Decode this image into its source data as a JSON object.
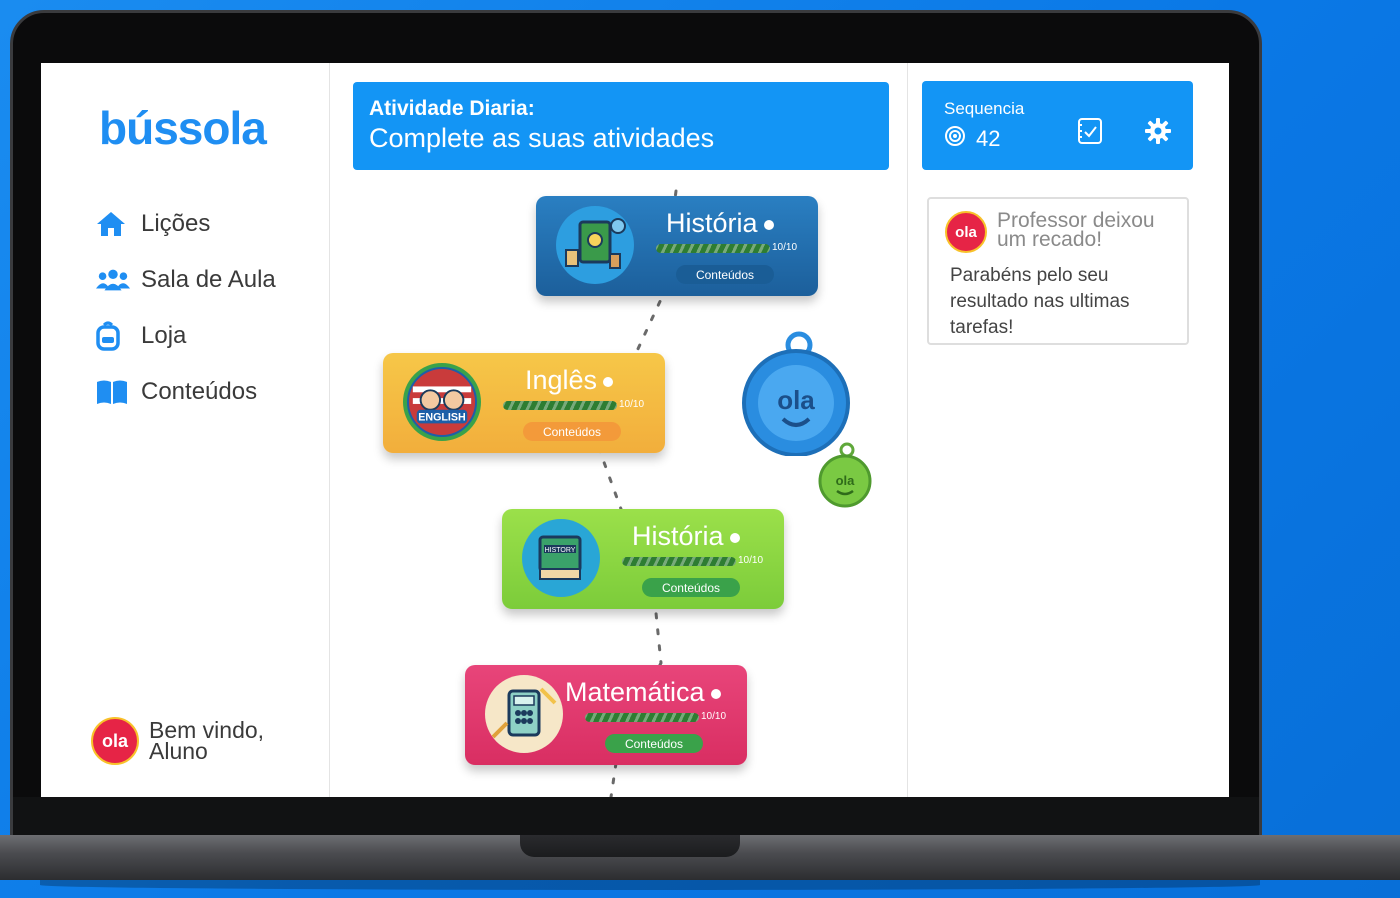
{
  "brand": {
    "logo": "bússola"
  },
  "sidebar": {
    "items": [
      {
        "label": "Lições",
        "icon": "home-icon"
      },
      {
        "label": "Sala de Aula",
        "icon": "users-icon"
      },
      {
        "label": "Loja",
        "icon": "backpack-icon"
      },
      {
        "label": "Conteúdos",
        "icon": "book-icon"
      }
    ],
    "welcome_line1": "Bem vindo,",
    "welcome_line2": "Aluno",
    "avatar_text": "ola"
  },
  "daily": {
    "title": "Atividade Diaria:",
    "subtitle": "Complete as suas atividades"
  },
  "lessons": [
    {
      "title": "História",
      "progress": "10/10",
      "progress_fraction": 1.0,
      "button": "Conteúdos",
      "color": "#1f6fb0",
      "button_color": "#1a5d96",
      "thumb": "history-books-icon"
    },
    {
      "title": "Inglês",
      "progress": "10/10",
      "progress_fraction": 1.0,
      "button": "Conteúdos",
      "color": "#f4b93e",
      "button_color": "#f39a3a",
      "thumb": "english-badge-icon"
    },
    {
      "title": "História",
      "progress": "10/10",
      "progress_fraction": 1.0,
      "button": "Conteúdos",
      "color": "#8ed63e",
      "button_color": "#3aa24a",
      "thumb": "history-book-icon"
    },
    {
      "title": "Matemática",
      "progress": "10/10",
      "progress_fraction": 1.0,
      "button": "Conteúdos",
      "color": "#e23e6e",
      "button_color": "#3aa24a",
      "thumb": "math-calculator-icon"
    }
  ],
  "streak": {
    "label": "Sequencia",
    "value": "42"
  },
  "message": {
    "avatar_text": "ola",
    "heading": "Professor deixou um recado!",
    "body": "Parabéns pelo seu resultado nas ultimas tarefas!"
  },
  "stickers": [
    {
      "text": "ola",
      "color": "#2a8de0"
    },
    {
      "text": "ola",
      "color": "#7ac943"
    }
  ]
}
